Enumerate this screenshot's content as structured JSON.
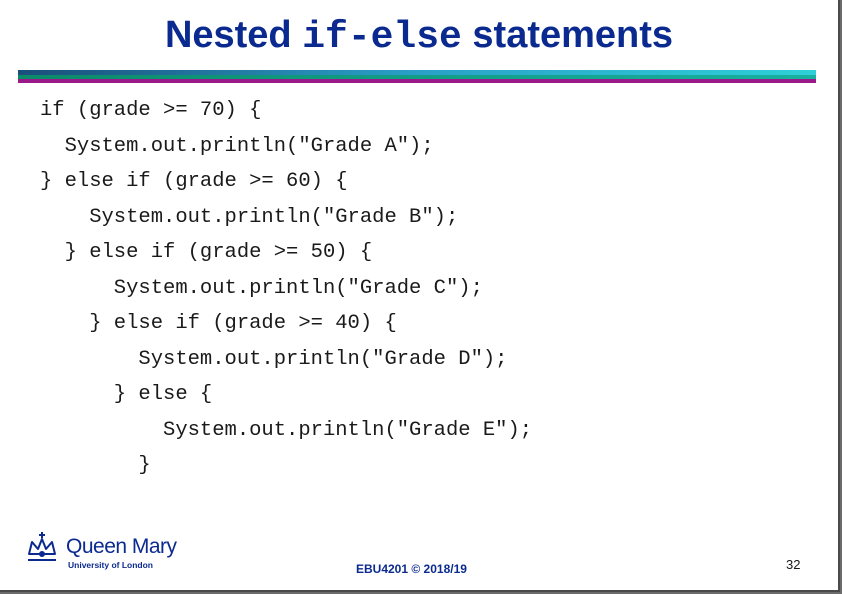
{
  "slide": {
    "title_pre": "Nested ",
    "title_code": "if-else",
    "title_post": " statements",
    "code_lines": [
      "if (grade >= 70) {",
      "  System.out.println(\"Grade A\");",
      "} else if (grade >= 60) {",
      "    System.out.println(\"Grade B\");",
      "  } else if (grade >= 50) {",
      "      System.out.println(\"Grade C\");",
      "    } else if (grade >= 40) {",
      "        System.out.println(\"Grade D\");",
      "      } else {",
      "          System.out.println(\"Grade E\");",
      "        }"
    ]
  },
  "footer": {
    "logo_name": "Queen Mary",
    "logo_subtitle": "University of London",
    "course": "EBU4201 © 2018/19",
    "page_number": "32"
  },
  "colors": {
    "title": "#0b2a8f",
    "accent_bar_top": "#2aa0c8",
    "accent_bar_mid": "#18b0a0",
    "accent_bar_bottom": "#9a1a8a"
  },
  "icons": {
    "logo": "crown-icon"
  }
}
